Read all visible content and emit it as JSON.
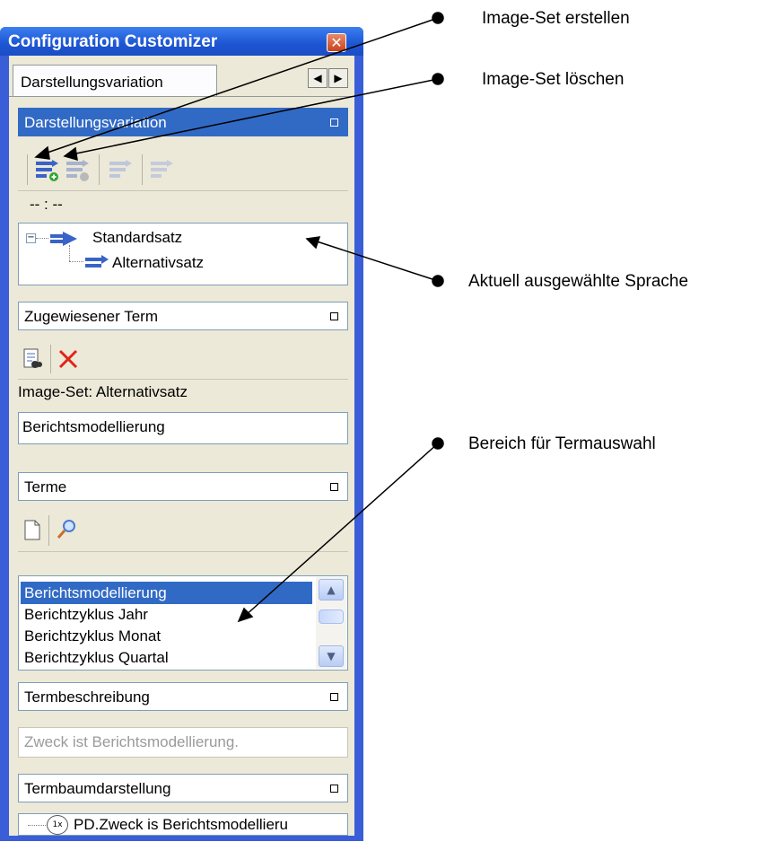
{
  "window": {
    "title": "Configuration Customizer",
    "close_glyph": "✕",
    "tab_label": "Darstellungsvariation",
    "nav_left": "◀",
    "nav_right": "▶"
  },
  "sections": {
    "darstellung": {
      "header": "Darstellungsvariation",
      "time_text": "-- : --",
      "tree": {
        "root": "Standardsatz",
        "child": "Alternativsatz"
      },
      "toolbar_icons": [
        "image-set-create-icon",
        "image-set-delete-icon",
        "image-set-edit-icon",
        "image-set-disabled-icon"
      ]
    },
    "zugewiesen": {
      "header": "Zugewiesener Term",
      "image_set_label": "Image-Set: Alternativsatz",
      "value": "Berichtsmodellierung"
    },
    "terme": {
      "header": "Terme",
      "items": [
        "Berichtsmodellierung",
        "Berichtzyklus Jahr",
        "Berichtzyklus Monat",
        "Berichtzyklus Quartal"
      ],
      "selected_index": 0
    },
    "beschreibung": {
      "header": "Termbeschreibung",
      "placeholder": "Zweck ist Berichtsmodellierung."
    },
    "baum": {
      "header": "Termbaumdarstellung",
      "node_badge": "1x",
      "node_text": "PD.Zweck is Berichtsmodellieru"
    }
  },
  "annotations": {
    "create": "Image-Set erstellen",
    "delete": "Image-Set löschen",
    "language": "Aktuell ausgewählte Sprache",
    "term_area": "Bereich für Termauswahl"
  },
  "colors": {
    "titlebar": "#1d55d2",
    "selection": "#316ac5",
    "panel": "#ece9d8",
    "delete_red": "#e2231a"
  }
}
